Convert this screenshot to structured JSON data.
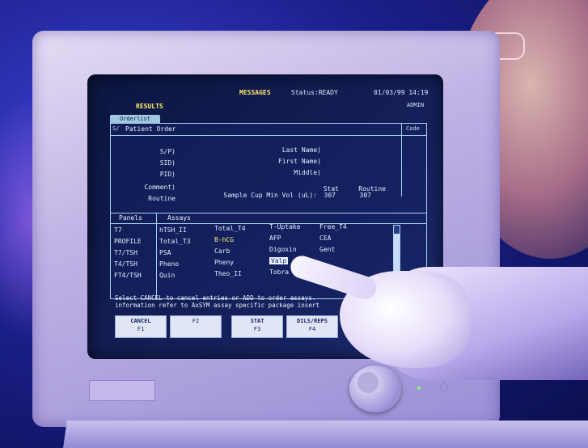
{
  "screen": {
    "messages": "MESSAGES",
    "status": "Status:READY",
    "datetime": "01/03/99 14:19",
    "results": "RESULTS",
    "user": "ADMIN",
    "orderlist_tab": "Orderlist",
    "s_col": "S/",
    "title": "Patient Order",
    "code_col": "Code",
    "fields": {
      "sp": "S/P)",
      "sid": "SID)",
      "pid": "PID)",
      "comment": "Comment)",
      "routine": "Routine",
      "last_name": "Last Name)",
      "first_name": "First Name)",
      "middle": "Middle)",
      "sample_cup": "Sample Cup Min Vol (uL):",
      "stat_label": "Stat",
      "stat_val": "307",
      "routine_label": "Routine",
      "routine_val": "307"
    },
    "headers": {
      "panels": "Panels",
      "assays": "Assays"
    },
    "panels": [
      "T7",
      "PROFILE",
      "T7/TSH",
      "T4/TSH",
      "FT4/TSH"
    ],
    "assays_col1": [
      "hTSH_II",
      "Total_T3",
      "PSA",
      "Pheno",
      "Quin"
    ],
    "assays_col2": [
      "Total_T4",
      "B-hCG",
      "Carb",
      "Pheny",
      "Theo_II"
    ],
    "assays_col3": [
      "T-Uptake",
      "AFP",
      "Digoxin",
      "Valp",
      "Tobra"
    ],
    "assays_col4": [
      "Free_T4",
      "CEA",
      "Gent"
    ],
    "hint_line1": "Select CANCEL to cancel entries or ADD to order assays.",
    "hint_line2": "information refer to AxSYM assay specific package insert",
    "fkeys": [
      {
        "label": "CANCEL",
        "key": "F1"
      },
      {
        "label": "",
        "key": "F2"
      },
      {
        "label": "STAT",
        "key": "F3"
      },
      {
        "label": "DILS/REPS",
        "key": "F4"
      }
    ]
  }
}
